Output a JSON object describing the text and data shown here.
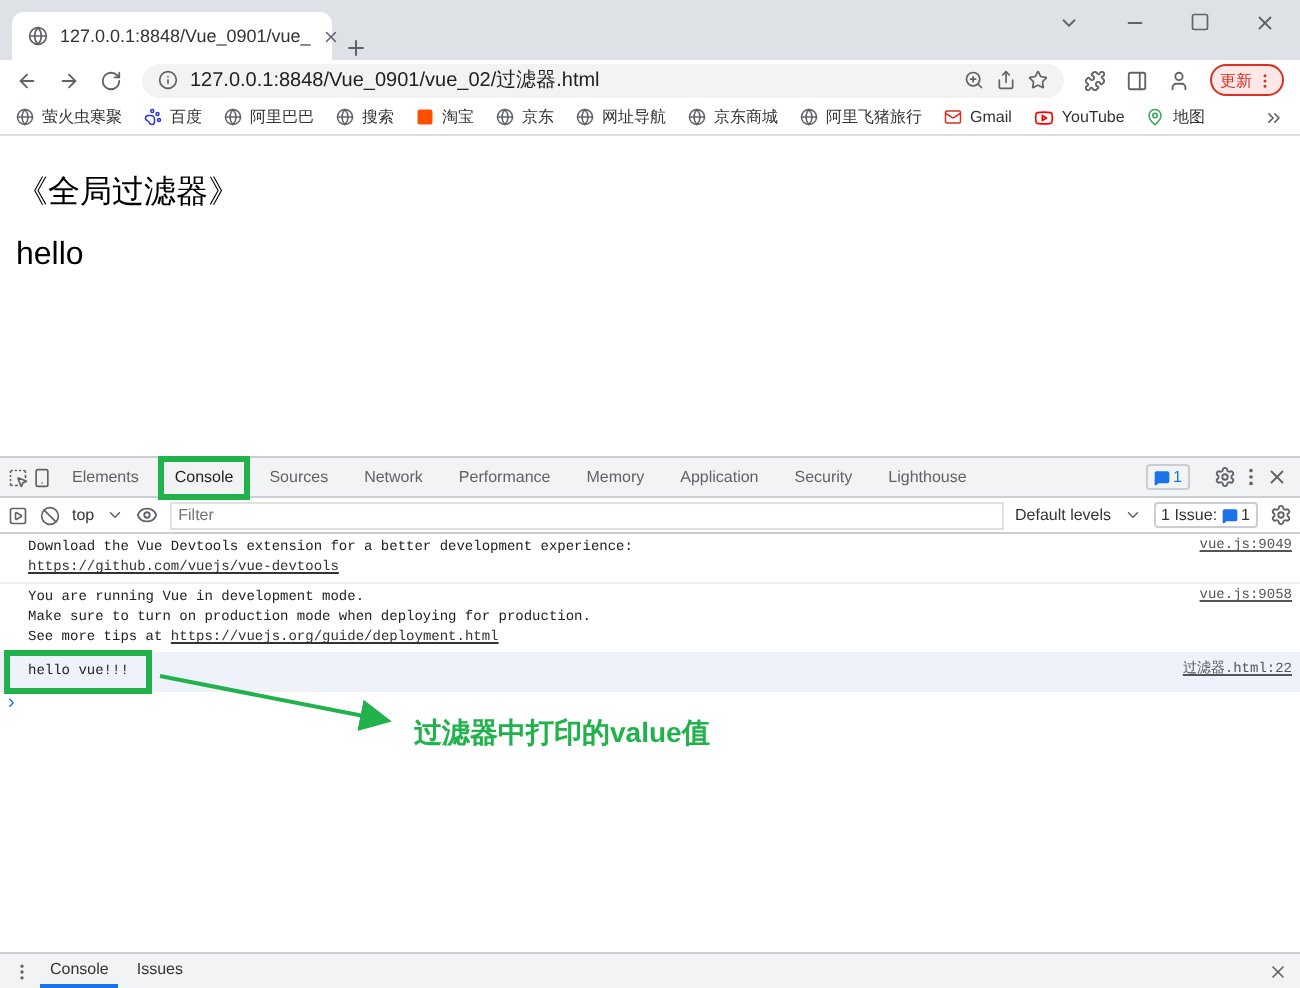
{
  "browser": {
    "tabs": [
      {
        "title": "127.0.0.1:8848/Vue_0901/vue_",
        "selected": true
      }
    ],
    "address": "127.0.0.1:8848/Vue_0901/vue_02/过滤器.html",
    "update_button": "更新",
    "bookmarks": [
      {
        "label": "萤火虫寒聚",
        "kind": "globe"
      },
      {
        "label": "百度",
        "kind": "paw"
      },
      {
        "label": "阿里巴巴",
        "kind": "globe"
      },
      {
        "label": "搜索",
        "kind": "globe"
      },
      {
        "label": "淘宝",
        "kind": "taobao"
      },
      {
        "label": "京东",
        "kind": "globe"
      },
      {
        "label": "网址导航",
        "kind": "globe"
      },
      {
        "label": "京东商城",
        "kind": "globe"
      },
      {
        "label": "阿里飞猪旅行",
        "kind": "globe"
      },
      {
        "label": "Gmail",
        "kind": "mail"
      },
      {
        "label": "YouTube",
        "kind": "play"
      },
      {
        "label": "地图",
        "kind": "map"
      }
    ]
  },
  "page": {
    "heading": "《全局过滤器》",
    "text": "hello"
  },
  "devtools": {
    "tabs": [
      {
        "label": "Elements",
        "selected": false,
        "outlined": false
      },
      {
        "label": "Console",
        "selected": true,
        "outlined": true
      },
      {
        "label": "Sources",
        "selected": false,
        "outlined": false
      },
      {
        "label": "Network",
        "selected": false,
        "outlined": false
      },
      {
        "label": "Performance",
        "selected": false,
        "outlined": false
      },
      {
        "label": "Memory",
        "selected": false,
        "outlined": false
      },
      {
        "label": "Application",
        "selected": false,
        "outlined": false
      },
      {
        "label": "Security",
        "selected": false,
        "outlined": false
      },
      {
        "label": "Lighthouse",
        "selected": false,
        "outlined": false
      }
    ],
    "message_count": "1",
    "context": "top",
    "filter_placeholder": "Filter",
    "levels": "Default levels",
    "issues_label": "1 Issue:",
    "issues_count": "1",
    "messages": [
      {
        "kind": "info",
        "source": "vue.js:9049",
        "lines": [
          {
            "text": "Download the Vue Devtools extension for a better development experience:"
          },
          {
            "link": "https://github.com/vuejs/vue-devtools"
          }
        ]
      },
      {
        "kind": "info",
        "source": "vue.js:9058",
        "lines": [
          {
            "text": "You are running Vue in development mode."
          },
          {
            "text": "Make sure to turn on production mode when deploying for production."
          },
          {
            "text": "See more tips at ",
            "link": "https://vuejs.org/guide/deployment.html"
          }
        ]
      },
      {
        "kind": "log",
        "outlined": true,
        "source": "过滤器.html:22",
        "lines": [
          {
            "text": "hello vue!!!"
          }
        ]
      }
    ],
    "prompt": "›",
    "drawer_tabs": [
      {
        "label": "Console",
        "selected": true
      },
      {
        "label": "Issues",
        "selected": false
      }
    ]
  },
  "annotation": {
    "text": "过滤器中打印的value值"
  }
}
